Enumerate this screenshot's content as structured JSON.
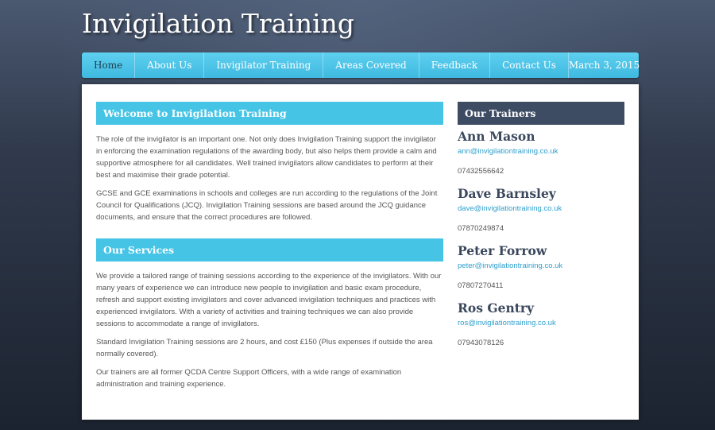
{
  "header": {
    "site_title": "Invigilation Training"
  },
  "nav": {
    "items": [
      {
        "label": "Home",
        "active": true
      },
      {
        "label": "About Us"
      },
      {
        "label": "Invigilator Training"
      },
      {
        "label": "Areas Covered"
      },
      {
        "label": "Feedback"
      },
      {
        "label": "Contact Us"
      }
    ],
    "date": "March 3, 2015"
  },
  "main": {
    "welcome": {
      "heading": "Welcome to Invigilation Training",
      "paragraphs": [
        "The role of the invigilator is an important one. Not only does Invigilation Training support the invigilator in enforcing the examination regulations of the awarding body, but also helps them provide a calm and supportive atmosphere for all candidates. Well trained invigilators allow candidates to perform at their best and maximise their grade potential.",
        "GCSE and GCE examinations in schools and colleges are run according to the regulations of the Joint Council for Qualifications (JCQ). Invigilation Training sessions are based around the JCQ guidance documents, and ensure that the correct procedures are followed."
      ]
    },
    "services": {
      "heading": "Our Services",
      "paragraphs": [
        "We provide a tailored range of training sessions according to the experience of the invigilators. With our many years of experience we can introduce new people to invigilation and basic exam procedure, refresh and support existing invigilators and cover advanced invigilation techniques and practices with experienced invigilators. With a variety of activities and training techniques we can also provide sessions to accommodate a range of invigilators.",
        "Standard Invigilation Training sessions are 2 hours, and cost £150 (Plus expenses if outside the area normally covered).",
        "Our trainers are all former QCDA Centre Support Officers, with a wide range of examination administration and training experience."
      ]
    }
  },
  "sidebar": {
    "heading": "Our Trainers",
    "trainers": [
      {
        "name": "Ann Mason",
        "email": "ann@invigilationtraining.co.uk",
        "phone": "07432556642"
      },
      {
        "name": "Dave Barnsley",
        "email": "dave@invigilationtraining.co.uk",
        "phone": "07870249874"
      },
      {
        "name": "Peter Forrow",
        "email": "peter@invigilationtraining.co.uk",
        "phone": "07807270411"
      },
      {
        "name": "Ros Gentry",
        "email": "ros@invigilationtraining.co.uk",
        "phone": "07943078126"
      }
    ]
  },
  "colors": {
    "accent": "#45c4e6",
    "sidebar_heading": "#3d4b63",
    "link": "#2e9fcc"
  }
}
